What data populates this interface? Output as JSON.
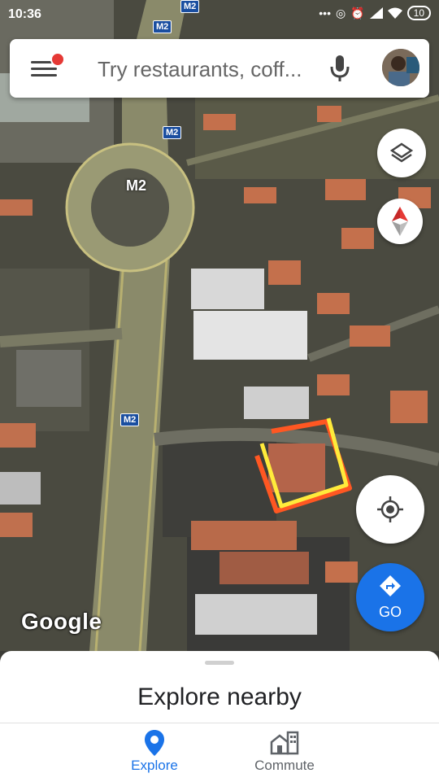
{
  "status": {
    "time": "10:36",
    "battery": "10"
  },
  "search": {
    "placeholder": "Try restaurants, coff..."
  },
  "map": {
    "road_name": "M2",
    "road_shields": [
      "M2",
      "M2",
      "M2",
      "M2"
    ],
    "attribution": "Google"
  },
  "go": {
    "label": "GO"
  },
  "sheet": {
    "title": "Explore nearby"
  },
  "nav": {
    "explore": "Explore",
    "commute": "Commute"
  },
  "colors": {
    "accent": "#1a73e8",
    "marker_outer": "#ffeb3b",
    "marker_inner": "#ff5722",
    "notification_dot": "#e53935"
  }
}
